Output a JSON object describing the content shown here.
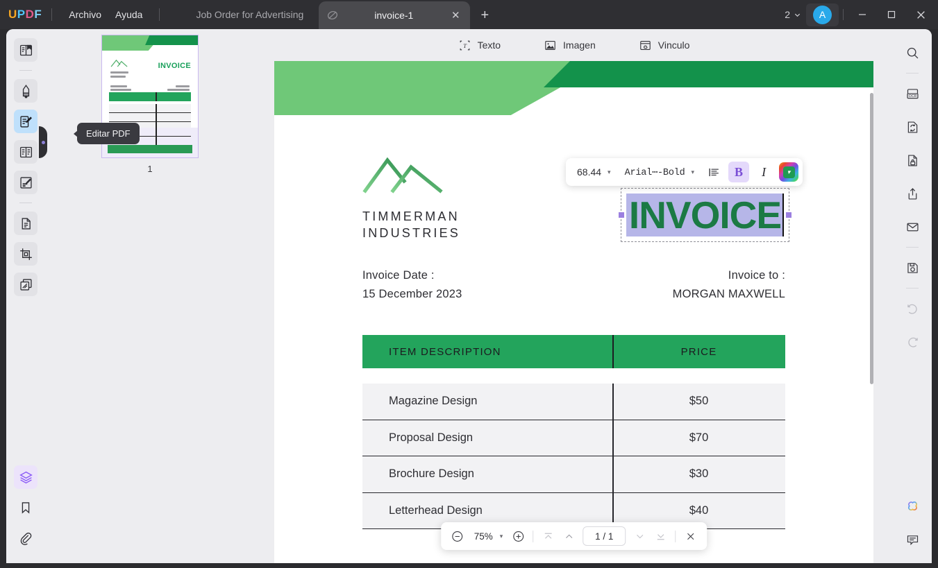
{
  "app": {
    "brand": "UPDF",
    "brand_letters": [
      "U",
      "P",
      "D",
      "F"
    ],
    "menus": [
      {
        "label": "Archivo",
        "name": "menu-archivo"
      },
      {
        "label": "Ayuda",
        "name": "menu-ayuda"
      }
    ],
    "tabs": [
      {
        "label": "Job Order for Advertising",
        "active": false
      },
      {
        "label": "invoice-1",
        "active": true
      }
    ],
    "new_tab_label": "+",
    "tab_close_label": "✕",
    "window_count": "2",
    "avatar_initial": "A",
    "window_controls": {
      "minimize": "—",
      "maximize": "□",
      "close": "✕"
    }
  },
  "left_rail": {
    "items": [
      {
        "name": "sidebar-item-reader",
        "icon": "book-reader-icon",
        "active": false
      },
      {
        "name": "sidebar-item-annotate",
        "icon": "highlighter-icon",
        "active": false
      },
      {
        "name": "sidebar-item-edit-pdf",
        "icon": "edit-pdf-icon",
        "active": true
      },
      {
        "name": "sidebar-item-page-tools",
        "icon": "page-organize-icon",
        "active": false
      },
      {
        "name": "sidebar-item-form",
        "icon": "form-fill-icon",
        "active": false
      },
      {
        "name": "sidebar-item-convert",
        "icon": "convert-file-icon",
        "active": false
      },
      {
        "name": "sidebar-item-crop",
        "icon": "crop-icon",
        "active": false
      },
      {
        "name": "sidebar-item-compare",
        "icon": "compare-pages-icon",
        "active": false
      }
    ],
    "bottom_items": [
      {
        "name": "sidebar-item-layers",
        "icon": "layers-icon",
        "active": true
      },
      {
        "name": "sidebar-item-bookmark",
        "icon": "bookmark-icon",
        "active": false
      },
      {
        "name": "sidebar-item-attachment",
        "icon": "paperclip-icon",
        "active": false
      }
    ]
  },
  "tooltip": {
    "text": "Editar PDF"
  },
  "thumbnails": {
    "pages": [
      {
        "number": "1"
      }
    ]
  },
  "edit_toolbar": {
    "tools": [
      {
        "label": "Texto",
        "icon": "text-tool-icon",
        "name": "edit-tool-texto"
      },
      {
        "label": "Imagen",
        "icon": "image-tool-icon",
        "name": "edit-tool-imagen"
      },
      {
        "label": "Vinculo",
        "icon": "link-tool-icon",
        "name": "edit-tool-vinculo"
      }
    ]
  },
  "format_bar": {
    "font_size": "68.44",
    "font_family": "Arial⋯-Bold",
    "align_icon": "align-left-icon",
    "bold_label": "B",
    "italic_label": "I",
    "color_swatch": "#1f9b53",
    "caret": "▾"
  },
  "document": {
    "selected_text": "INVOICE",
    "brand_line1": "TIMMERMAN",
    "brand_line2": "INDUSTRIES",
    "invoice_date_label": "Invoice Date :",
    "invoice_date_value": "15 December 2023",
    "invoice_to_label": "Invoice to :",
    "invoice_to_value": "MORGAN MAXWELL",
    "table": {
      "headers": [
        "ITEM DESCRIPTION",
        "PRICE"
      ],
      "rows": [
        {
          "item": "Magazine Design",
          "price": "$50"
        },
        {
          "item": "Proposal Design",
          "price": "$70"
        },
        {
          "item": "Brochure Design",
          "price": "$30"
        },
        {
          "item": "Letterhead Design",
          "price": "$40"
        }
      ]
    },
    "colors": {
      "band_light_green": "#6fc878",
      "band_dark_green": "#13924b",
      "table_header_green": "#23a45c",
      "invoice_text_green": "#1b7a44",
      "selection_highlight": "#b6b6e8"
    }
  },
  "zoom_bar": {
    "zoom_out_icon": "minus-circle-icon",
    "zoom_level": "75%",
    "zoom_in_icon": "plus-circle-icon",
    "first_page_icon": "first-page-icon",
    "prev_page_icon": "prev-page-icon",
    "page_indicator": "1 / 1",
    "next_page_icon": "next-page-icon",
    "last_page_icon": "last-page-icon",
    "close_icon": "close-icon",
    "caret": "▾"
  },
  "right_rail": {
    "items": [
      {
        "name": "search-icon",
        "label": "search"
      },
      {
        "name": "ocr-icon",
        "label": "OCR"
      },
      {
        "name": "convert-icon",
        "label": "convert"
      },
      {
        "name": "protect-icon",
        "label": "protect"
      },
      {
        "name": "share-icon",
        "label": "share"
      },
      {
        "name": "email-icon",
        "label": "email"
      },
      {
        "name": "save-icon",
        "label": "save"
      },
      {
        "name": "undo-icon",
        "label": "undo"
      },
      {
        "name": "redo-icon",
        "label": "redo"
      }
    ],
    "bottom_items": [
      {
        "name": "ai-assistant-icon",
        "label": "AI assistant"
      },
      {
        "name": "comment-icon",
        "label": "comment"
      }
    ]
  }
}
